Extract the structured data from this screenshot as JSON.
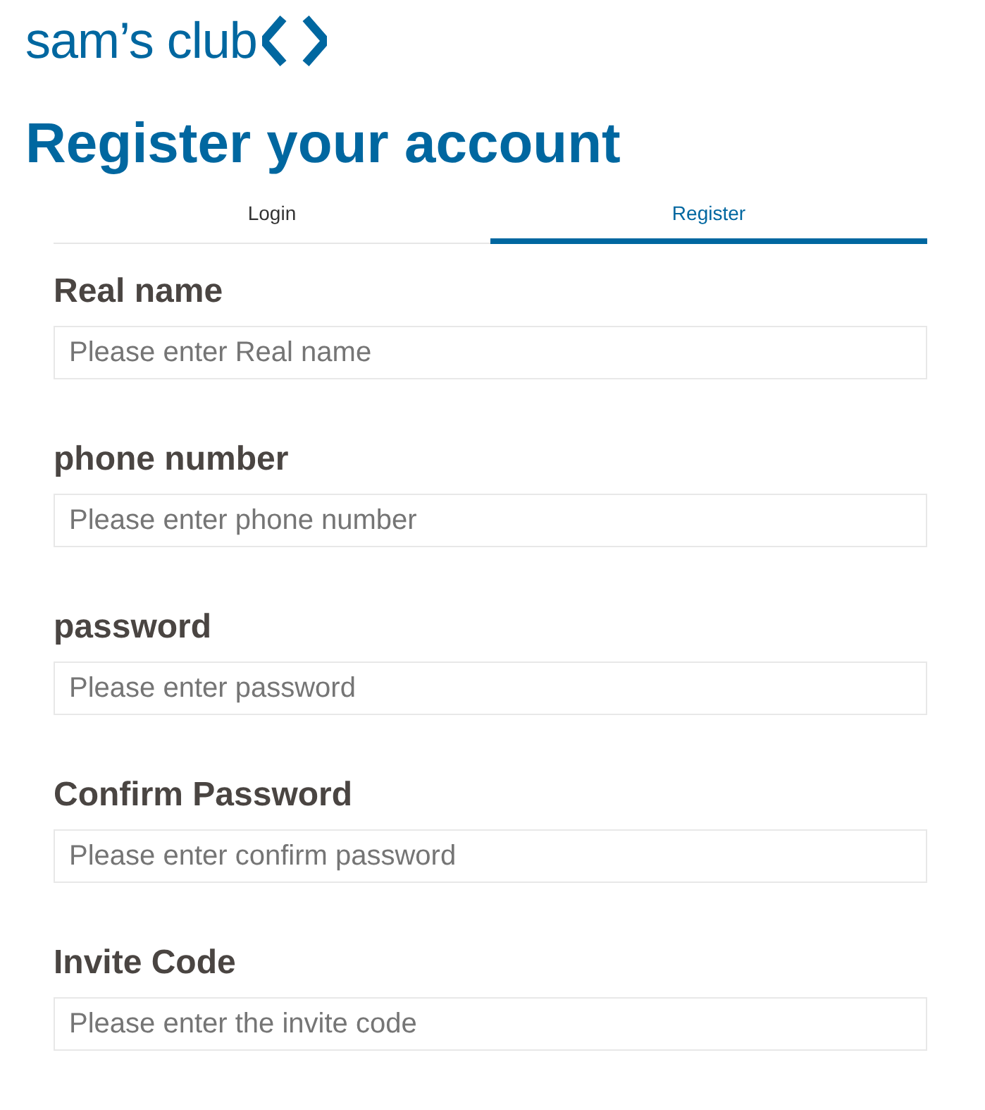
{
  "logo": {
    "text": "sam’s club"
  },
  "title": "Register your account",
  "tabs": [
    {
      "label": "Login",
      "selected": false
    },
    {
      "label": "Register",
      "selected": true
    }
  ],
  "fields": [
    {
      "label": "Real name",
      "placeholder": "Please enter Real name"
    },
    {
      "label": "phone number",
      "placeholder": "Please enter phone number"
    },
    {
      "label": "password",
      "placeholder": "Please enter password"
    },
    {
      "label": "Confirm Password",
      "placeholder": "Please enter confirm password"
    },
    {
      "label": "Invite Code",
      "placeholder": "Please enter the invite code"
    }
  ]
}
